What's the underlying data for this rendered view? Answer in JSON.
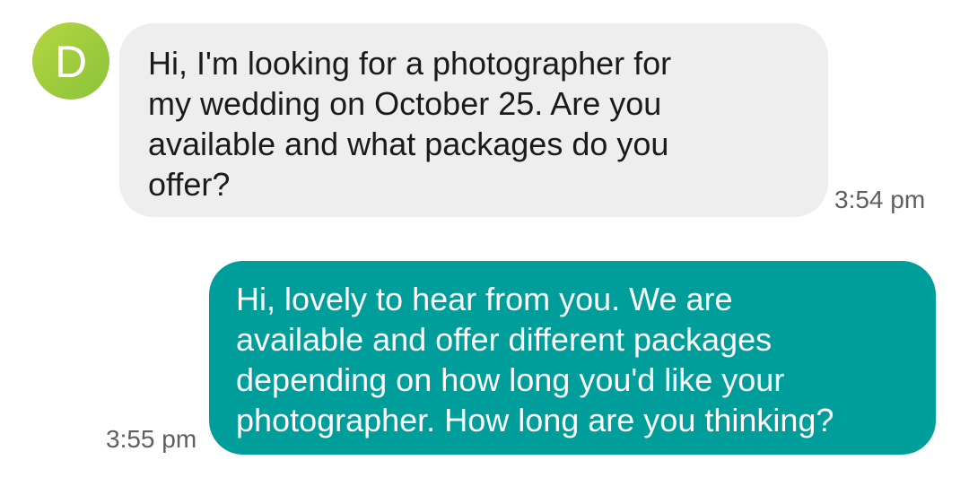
{
  "contact": {
    "avatar_initial": "D",
    "avatar_color": "#a6cf3e"
  },
  "messages": [
    {
      "direction": "incoming",
      "text": "Hi, I'm looking for a photographer for\nmy wedding on October 25. Are you\navailable and what packages do you\noffer?",
      "time": "3:54 pm",
      "bubble_color": "#eeeeee"
    },
    {
      "direction": "outgoing",
      "text": "Hi, lovely to hear from you. We are\navailable and offer different packages\ndepending on how long you'd like your\nphotographer. How long are you thinking?",
      "time": "3:55 pm",
      "bubble_color": "#009e9b"
    }
  ]
}
